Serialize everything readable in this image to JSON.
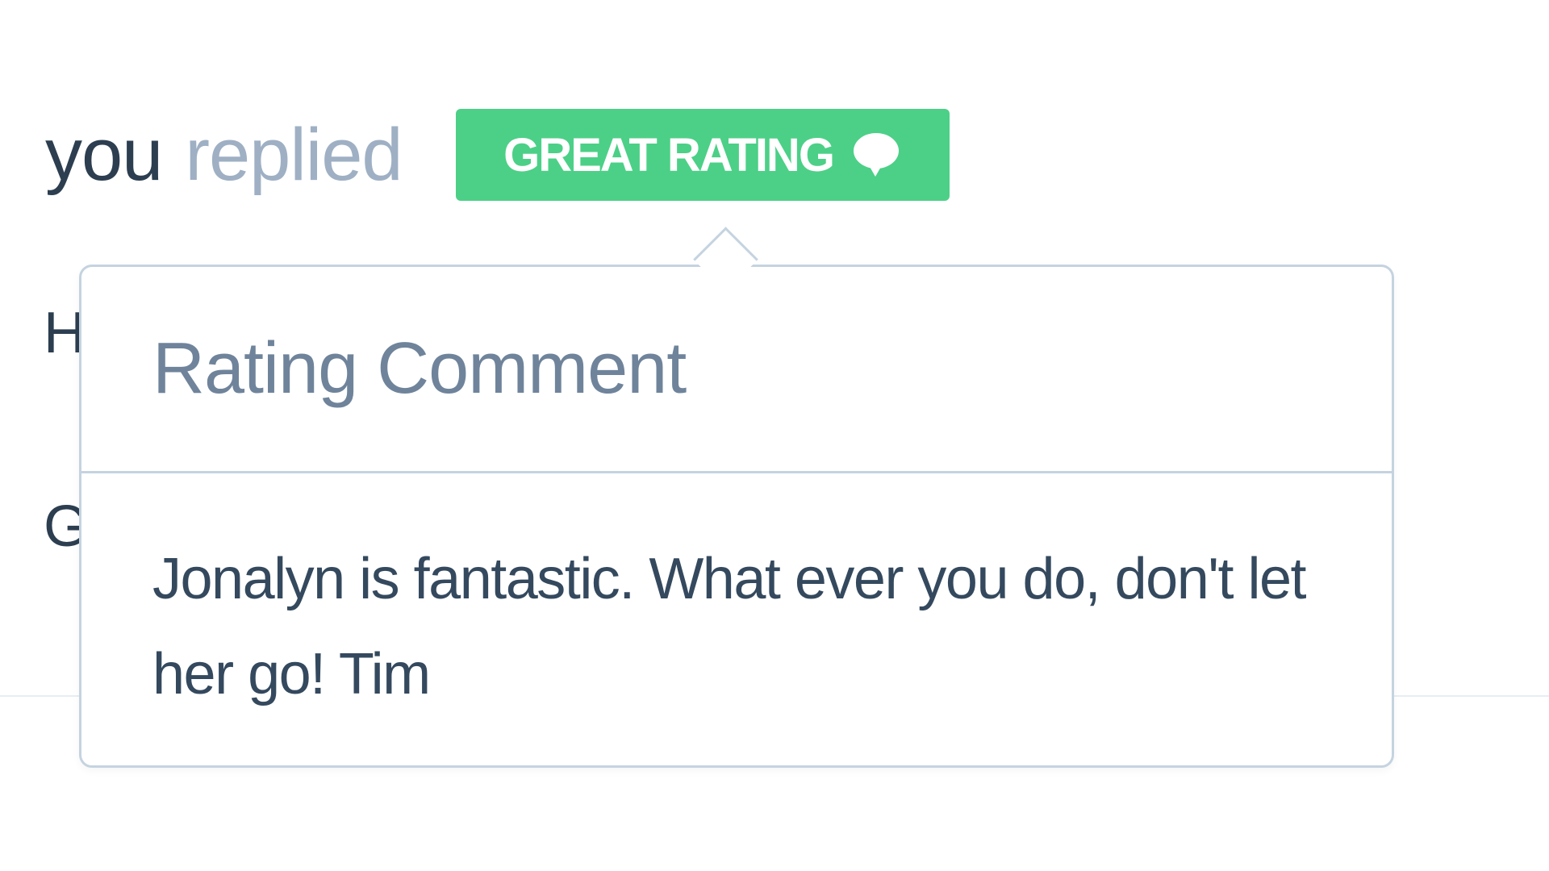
{
  "thread": {
    "author": "you",
    "action": "replied",
    "rating_badge": {
      "label": "GREAT RATING",
      "icon": "speech-bubble-icon",
      "color": "#4cd087"
    }
  },
  "background": {
    "partial_letters": [
      "H",
      "G"
    ]
  },
  "popover": {
    "title": "Rating Comment",
    "comment": "Jonalyn is fantastic. What ever you do, don't let her go! Tim",
    "border_color": "#c5d3e0"
  }
}
